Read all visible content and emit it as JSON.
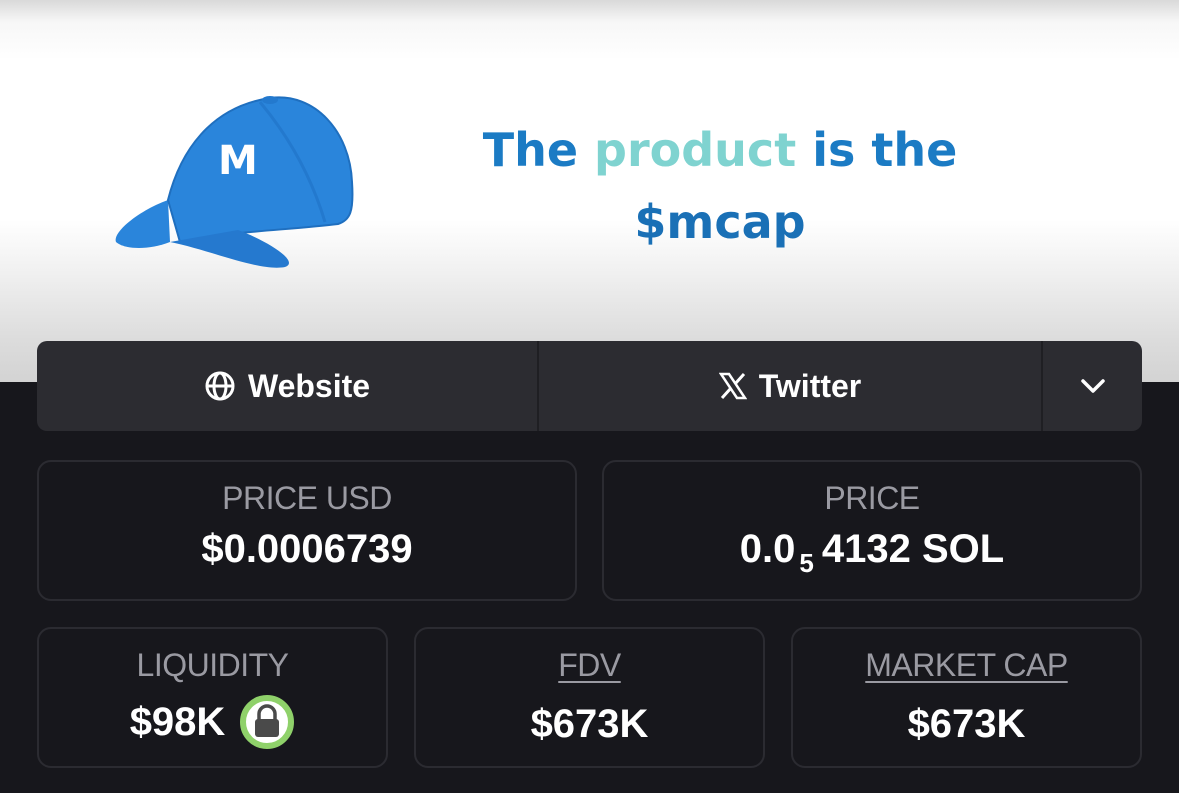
{
  "banner": {
    "logo_letter": "M",
    "tagline_parts": [
      "The ",
      "product",
      " is the"
    ],
    "tagline_line2": "$mcap",
    "colors": {
      "cap_blue": "#2a85db",
      "text_blue": "#1b7bc4",
      "highlight": "#7fd3d0"
    }
  },
  "links": {
    "website_label": "Website",
    "twitter_label": "Twitter",
    "website_icon": "globe-icon",
    "twitter_icon": "x-logo-icon",
    "more_icon": "chevron-down-icon"
  },
  "stats": {
    "price_usd": {
      "label": "PRICE USD",
      "value": "$0.0006739"
    },
    "price": {
      "label": "PRICE",
      "value_prefix": "0.0",
      "value_subscript": "5",
      "value_suffix": "4132 SOL"
    },
    "liquidity": {
      "label": "LIQUIDITY",
      "value": "$98K",
      "lock_icon": "lock-icon"
    },
    "fdv": {
      "label": "FDV",
      "value": "$673K"
    },
    "market_cap": {
      "label": "MARKET CAP",
      "value": "$673K"
    }
  },
  "colors": {
    "background": "#17171c",
    "card_border": "#2b2b31",
    "label": "#9a9aa2",
    "lock_ring": "#8fd16a"
  }
}
